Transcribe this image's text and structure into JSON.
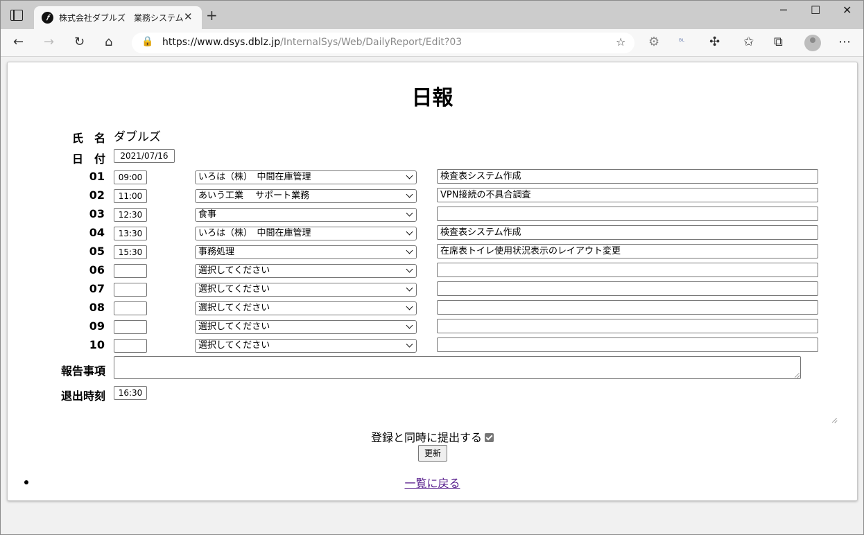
{
  "browser": {
    "tab_title": "株式会社ダブルズ　業務システム",
    "tab_close": "✕",
    "new_tab": "+",
    "url_main": "https://www.dsys.dblz.jp",
    "url_rest": "/InternalSys/Web/DailyReport/Edit?03",
    "controls": {
      "minimize": "─",
      "maximize": "☐",
      "close": "✕"
    }
  },
  "report": {
    "title": "日報",
    "name_label": "氏　名",
    "name_value": "ダブルズ",
    "date_label": "日　付",
    "date_value": "2021/07/16",
    "rows": [
      {
        "no": "01",
        "time": "09:00",
        "task": "いろは（株）　中間在庫管理",
        "detail": "検査表システム作成"
      },
      {
        "no": "02",
        "time": "11:00",
        "task": "あいう工業　 サポート業務",
        "detail": "VPN接続の不具合調査"
      },
      {
        "no": "03",
        "time": "12:30",
        "task": "食事",
        "detail": ""
      },
      {
        "no": "04",
        "time": "13:30",
        "task": "いろは（株）　中間在庫管理",
        "detail": "検査表システム作成"
      },
      {
        "no": "05",
        "time": "15:30",
        "task": "事務処理",
        "detail": "在席表トイレ使用状況表示のレイアウト変更"
      },
      {
        "no": "06",
        "time": "",
        "task": "選択してください",
        "detail": ""
      },
      {
        "no": "07",
        "time": "",
        "task": "選択してください",
        "detail": ""
      },
      {
        "no": "08",
        "time": "",
        "task": "選択してください",
        "detail": ""
      },
      {
        "no": "09",
        "time": "",
        "task": "選択してください",
        "detail": ""
      },
      {
        "no": "10",
        "time": "",
        "task": "選択してください",
        "detail": ""
      }
    ],
    "report_label": "報告事項",
    "report_value": "",
    "leave_label": "退出時刻",
    "leave_value": "16:30",
    "submit_label": "登録と同時に提出する",
    "submit_checked": true,
    "update_button": "更新",
    "back_link": "一覧に戻る"
  }
}
